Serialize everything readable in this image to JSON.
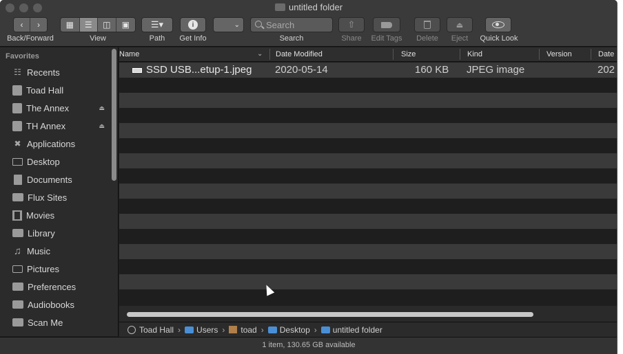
{
  "window": {
    "title": "untitled folder"
  },
  "toolbar": {
    "back_forward_label": "Back/Forward",
    "view_label": "View",
    "path_label": "Path",
    "get_info_label": "Get Info",
    "search_placeholder": "Search",
    "search_label": "Search",
    "share_label": "Share",
    "edit_tags_label": "Edit Tags",
    "delete_label": "Delete",
    "eject_label": "Eject",
    "quick_look_label": "Quick Look"
  },
  "sidebar": {
    "heading": "Favorites",
    "items": [
      {
        "label": "Recents",
        "icon": "recents-icon"
      },
      {
        "label": "Toad Hall",
        "icon": "disk-icon"
      },
      {
        "label": "The Annex",
        "icon": "disk-icon",
        "eject": true
      },
      {
        "label": "TH Annex",
        "icon": "disk-icon",
        "eject": true
      },
      {
        "label": "Applications",
        "icon": "applications-icon"
      },
      {
        "label": "Desktop",
        "icon": "desktop-icon"
      },
      {
        "label": "Documents",
        "icon": "documents-icon"
      },
      {
        "label": "Flux Sites",
        "icon": "folder-icon"
      },
      {
        "label": "Movies",
        "icon": "movies-icon"
      },
      {
        "label": "Library",
        "icon": "folder-icon"
      },
      {
        "label": "Music",
        "icon": "music-icon"
      },
      {
        "label": "Pictures",
        "icon": "pictures-icon"
      },
      {
        "label": "Preferences",
        "icon": "folder-icon"
      },
      {
        "label": "Audiobooks",
        "icon": "folder-icon"
      },
      {
        "label": "Scan Me",
        "icon": "folder-icon"
      }
    ]
  },
  "columns": {
    "name": "Name",
    "date_modified": "Date Modified",
    "size": "Size",
    "kind": "Kind",
    "version": "Version",
    "date_partial": "Date"
  },
  "files": [
    {
      "name": "SSD USB...etup-1.jpeg",
      "date_modified": "2020-05-14",
      "size": "160 KB",
      "kind": "JPEG image",
      "date_partial": "202"
    }
  ],
  "pathbar": {
    "segments": [
      "Toad Hall",
      "Users",
      "toad",
      "Desktop",
      "untitled folder"
    ]
  },
  "status": {
    "text": "1 item, 130.65 GB available"
  }
}
